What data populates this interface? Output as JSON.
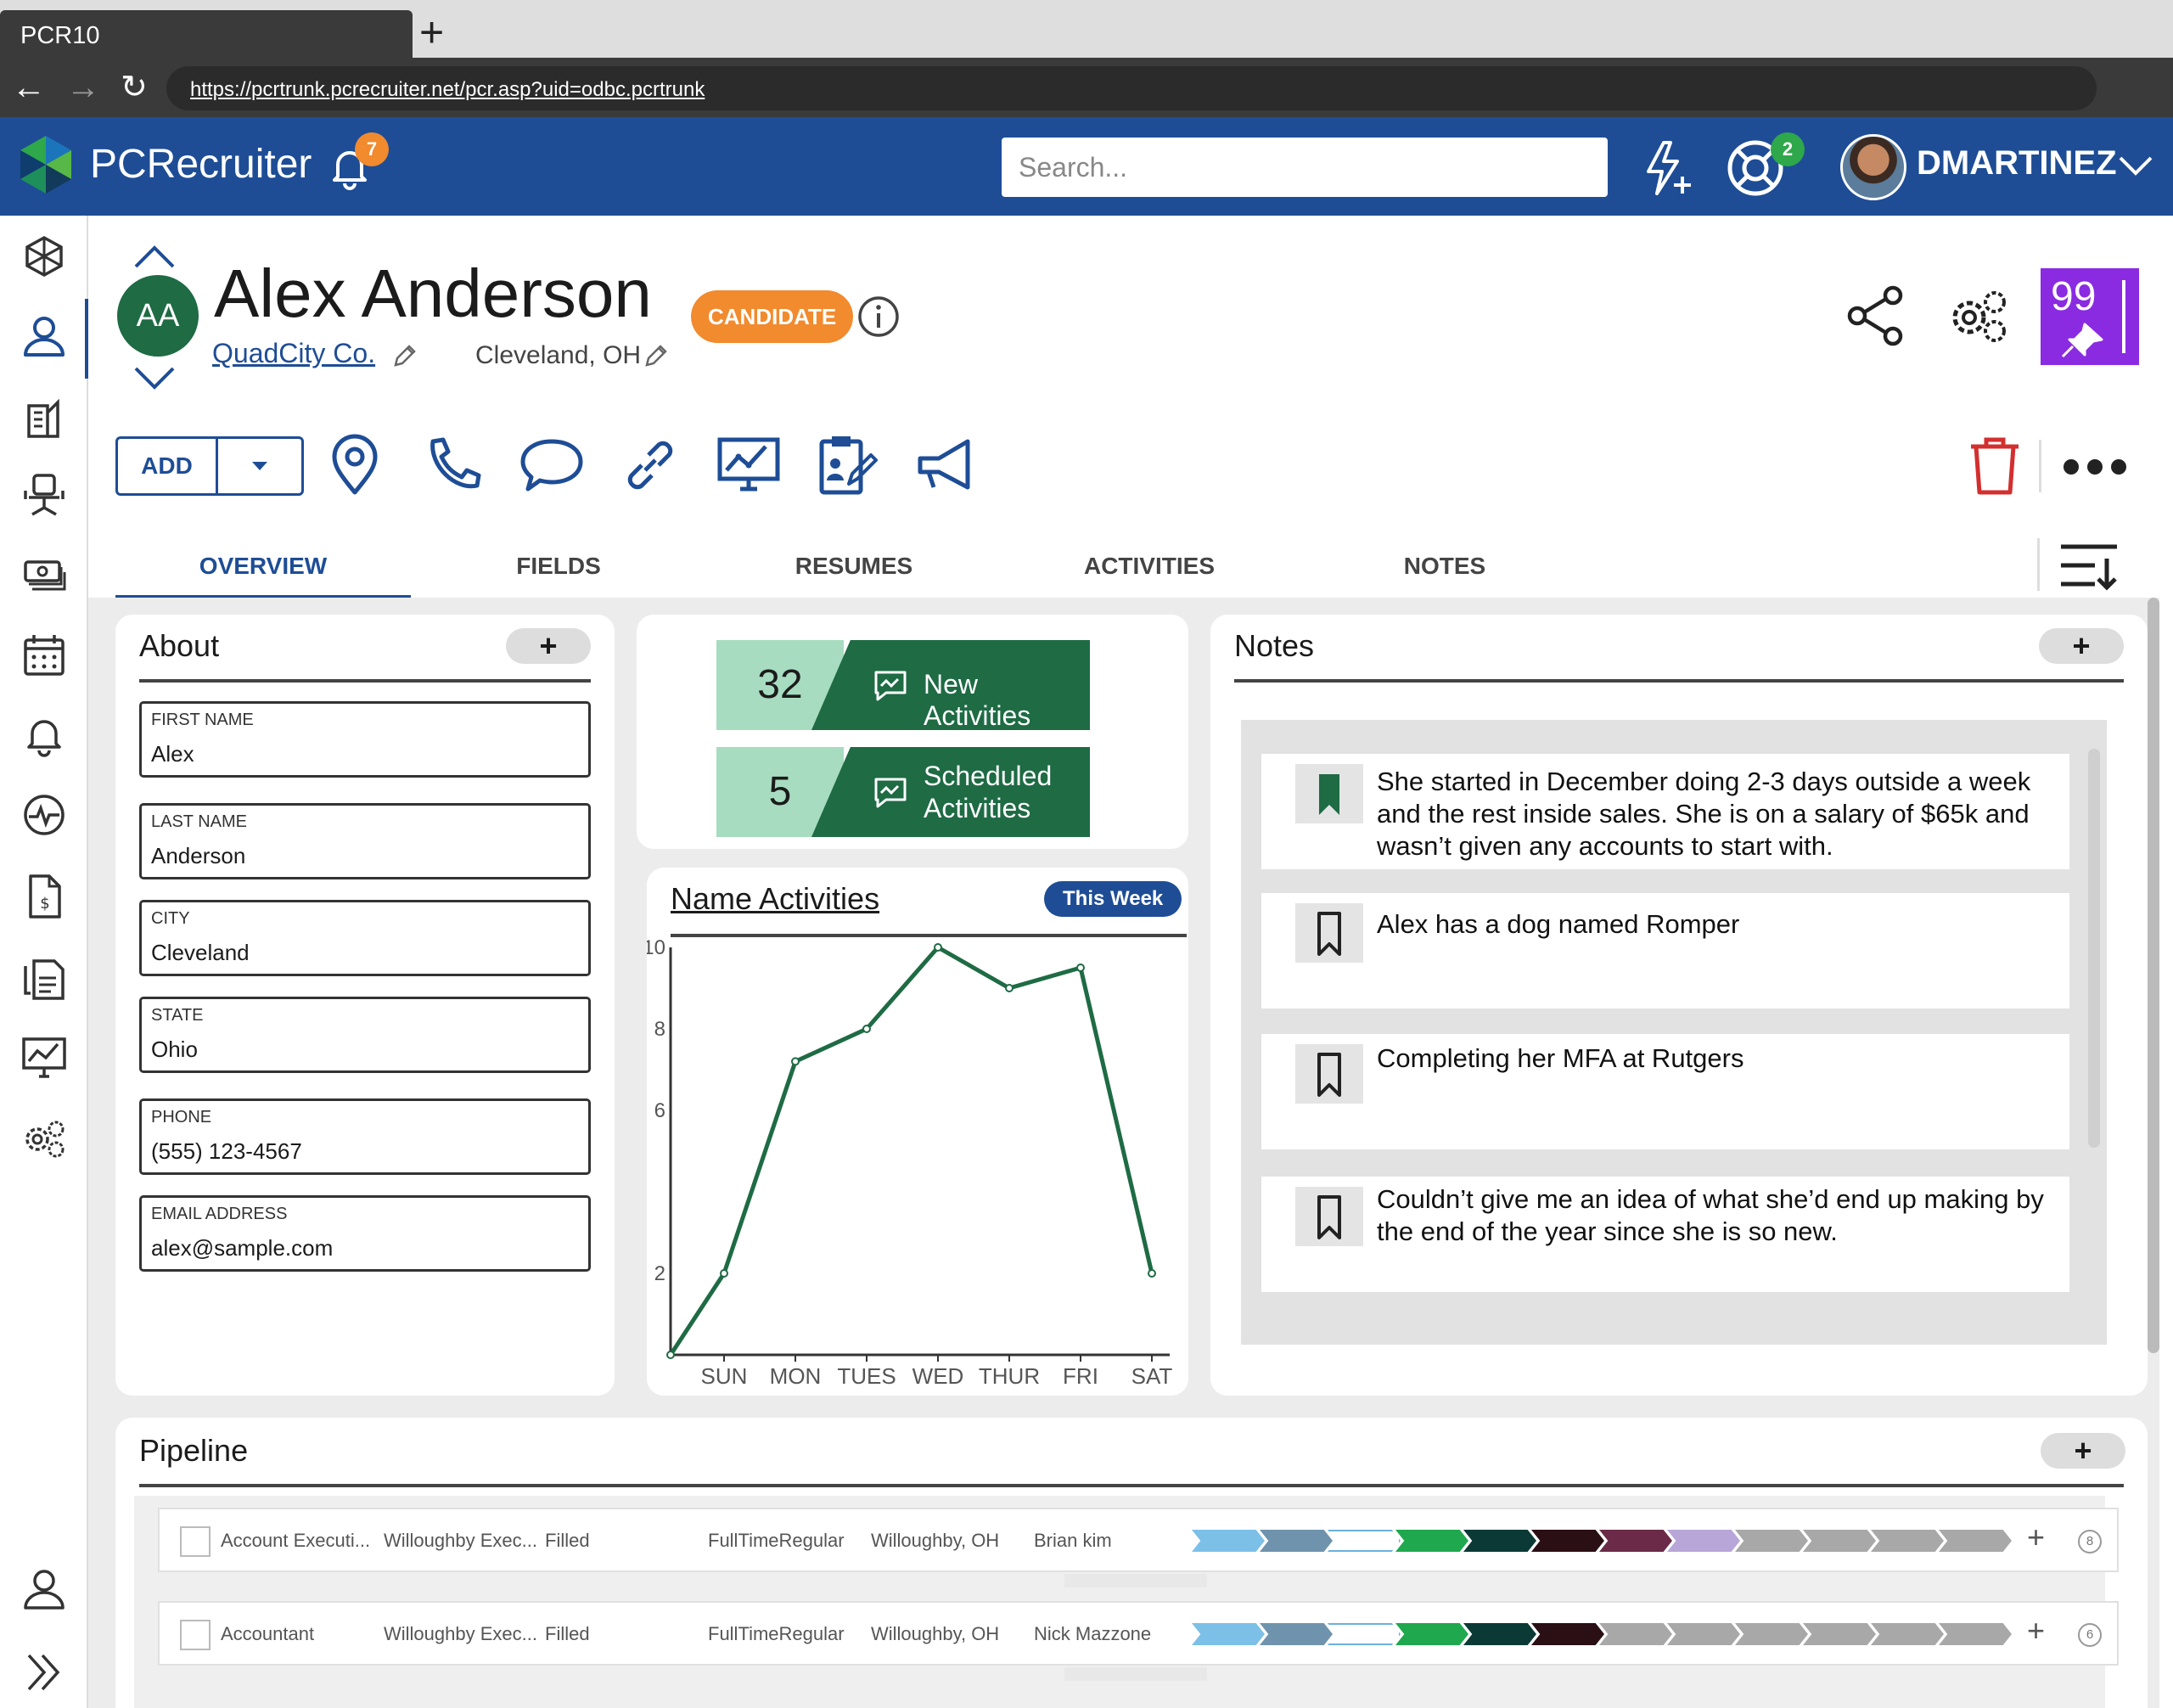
{
  "browser": {
    "tab_title": "PCR10",
    "url": "https://pcrtrunk.pcrecruiter.net/pcr.asp?uid=odbc.pcrtrunk"
  },
  "header": {
    "brand": "PCRecruiter",
    "notification_count": "7",
    "search_placeholder": "Search...",
    "help_count": "2",
    "username": "DMARTINEZ"
  },
  "record": {
    "initials": "AA",
    "name": "Alex Anderson",
    "company": "QuadCity Co.",
    "location": "Cleveland, OH",
    "type_badge": "CANDIDATE",
    "score": "99"
  },
  "toolbar": {
    "add_label": "ADD",
    "action_icons": [
      "location-pin-icon",
      "phone-icon",
      "chat-icon",
      "link-icon",
      "analytics-icon",
      "clipboard-icon",
      "megaphone-icon"
    ]
  },
  "tabs": [
    {
      "label": "OVERVIEW",
      "active": true
    },
    {
      "label": "FIELDS",
      "active": false
    },
    {
      "label": "RESUMES",
      "active": false
    },
    {
      "label": "ACTIVITIES",
      "active": false
    },
    {
      "label": "NOTES",
      "active": false
    }
  ],
  "about": {
    "title": "About",
    "fields": [
      {
        "label": "FIRST NAME",
        "value": "Alex"
      },
      {
        "label": "LAST NAME",
        "value": "Anderson"
      },
      {
        "label": "CITY",
        "value": "Cleveland"
      },
      {
        "label": "STATE",
        "value": "Ohio"
      },
      {
        "label": "PHONE",
        "value": "(555) 123-4567"
      },
      {
        "label": "EMAIL ADDRESS",
        "value": "alex@sample.com"
      }
    ]
  },
  "activity_stats": {
    "new_count": "32",
    "new_label": "New Activities",
    "scheduled_count": "5",
    "scheduled_label_1": "Scheduled",
    "scheduled_label_2": "Activities"
  },
  "chart_data": {
    "type": "line",
    "title": "Name Activities",
    "filter": "This Week",
    "categories": [
      "SUN",
      "MON",
      "TUES",
      "WED",
      "THUR",
      "FRI",
      "SAT"
    ],
    "y_tick_labels": [
      "2",
      "6",
      "8",
      "10"
    ],
    "ylim": [
      0,
      10
    ],
    "series": [
      {
        "values": [
          0,
          2,
          7.2,
          8,
          10,
          9,
          9.5,
          2
        ],
        "x": [
          0,
          0.75,
          1.75,
          2.75,
          3.75,
          4.75,
          5.75,
          6.75
        ],
        "color": "#1e6b44"
      }
    ],
    "grid": false
  },
  "notes": {
    "title": "Notes",
    "items": [
      {
        "text": "She started in December doing 2-3 days outside a week and the rest inside sales. She is on a salary of $65k and wasn’t given any accounts to start with.",
        "bookmarked": true
      },
      {
        "text": "Alex has a dog named Romper",
        "bookmarked": false
      },
      {
        "text": "Completing her MFA at Rutgers",
        "bookmarked": false
      },
      {
        "text": "Couldn’t give me an idea of what she’d end up making by the end of the year since she is so new.",
        "bookmarked": false
      }
    ]
  },
  "pipeline": {
    "title": "Pipeline",
    "rows": [
      {
        "position": "Account Executi...",
        "company": "Willoughby Exec...",
        "status": "Filled",
        "type": "FullTimeRegular",
        "location": "Willoughby, OH",
        "contact": "Brian kim",
        "count": "8",
        "stages": [
          "#7cc0e8",
          "#6f93ad",
          "#ffffff",
          "#1fa84e",
          "#0b3a36",
          "#2a0f14",
          "#6a2a48",
          "#b8a6d8",
          "#a8a8a8",
          "#a8a8a8",
          "#a8a8a8",
          "#a8a8a8"
        ]
      },
      {
        "position": "Accountant",
        "company": "Willoughby Exec...",
        "status": "Filled",
        "type": "FullTimeRegular",
        "location": "Willoughby, OH",
        "contact": "Nick Mazzone",
        "count": "6",
        "stages": [
          "#7cc0e8",
          "#6f93ad",
          "#ffffff",
          "#1fa84e",
          "#0b3a36",
          "#2a0f14",
          "#a8a8a8",
          "#a8a8a8",
          "#a8a8a8",
          "#a8a8a8",
          "#a8a8a8",
          "#a8a8a8"
        ]
      }
    ]
  },
  "sidebar": {
    "icons": [
      "cube-icon",
      "person-icon",
      "buildings-icon",
      "office-chair-icon",
      "money-stack-icon",
      "calendar-icon",
      "bell-icon",
      "pulse-icon",
      "invoice-icon",
      "documents-icon",
      "chart-icon",
      "settings-icon",
      "user-bottom-icon",
      "expand-icon"
    ]
  },
  "colors": {
    "brand_blue": "#1e4d96",
    "accent_orange": "#f28a2e",
    "activity_green": "#1e6b44",
    "score_purple": "#8a2be2"
  }
}
